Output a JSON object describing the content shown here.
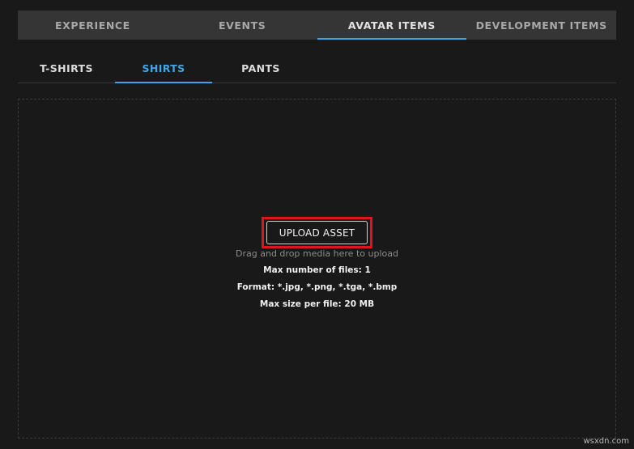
{
  "top_tabs": [
    {
      "label": "EXPERIENCE",
      "active": false
    },
    {
      "label": "EVENTS",
      "active": false
    },
    {
      "label": "AVATAR ITEMS",
      "active": true
    },
    {
      "label": "DEVELOPMENT ITEMS",
      "active": false
    }
  ],
  "sub_tabs": [
    {
      "label": "T-SHIRTS",
      "active": false
    },
    {
      "label": "SHIRTS",
      "active": true
    },
    {
      "label": "PANTS",
      "active": false
    }
  ],
  "upload": {
    "button_label": "UPLOAD ASSET",
    "drag_hint": "Drag and drop media here to upload",
    "max_files": "Max number of files: 1",
    "format": "Format: *.jpg, *.png, *.tga, *.bmp",
    "max_size": "Max size per file: 20 MB"
  },
  "watermark": "wsxdn.com",
  "colors": {
    "background": "#191919",
    "tab_bar": "#353535",
    "accent": "#35a6e8",
    "highlight": "#e0141a"
  }
}
